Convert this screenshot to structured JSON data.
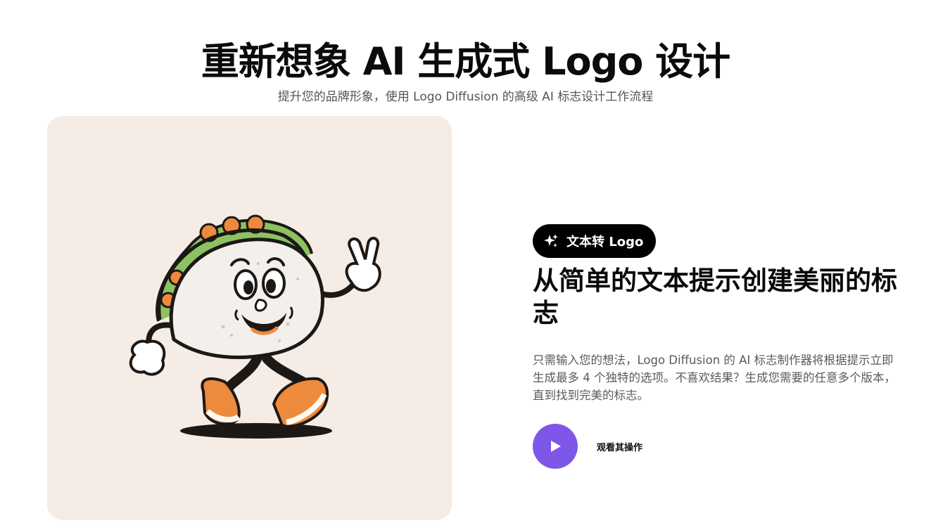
{
  "hero": {
    "title": "重新想象 AI 生成式 Logo 设计",
    "subtitle": "提升您的品牌形象，使用 Logo Diffusion 的高级 AI 标志设计工作流程"
  },
  "showcase": {
    "image_subject": "taco-mascot-illustration",
    "background_color": "#f4ece5"
  },
  "feature": {
    "badge_icon": "sparkles-icon",
    "badge_label": "文本转 Logo",
    "title": "从简单的文本提示创建美丽的标志",
    "description": "只需输入您的想法，Logo Diffusion 的 AI 标志制作器将根据提示立即生成最多 4 个独特的选项。不喜欢结果？生成您需要的任意多个版本，直到找到完美的标志。",
    "watch_icon": "play-icon",
    "watch_label": "观看其操作"
  },
  "colors": {
    "accent": "#7e57e8",
    "badge_bg": "#000000",
    "mascot_orange": "#ee8a3c",
    "mascot_green": "#8cc262"
  }
}
